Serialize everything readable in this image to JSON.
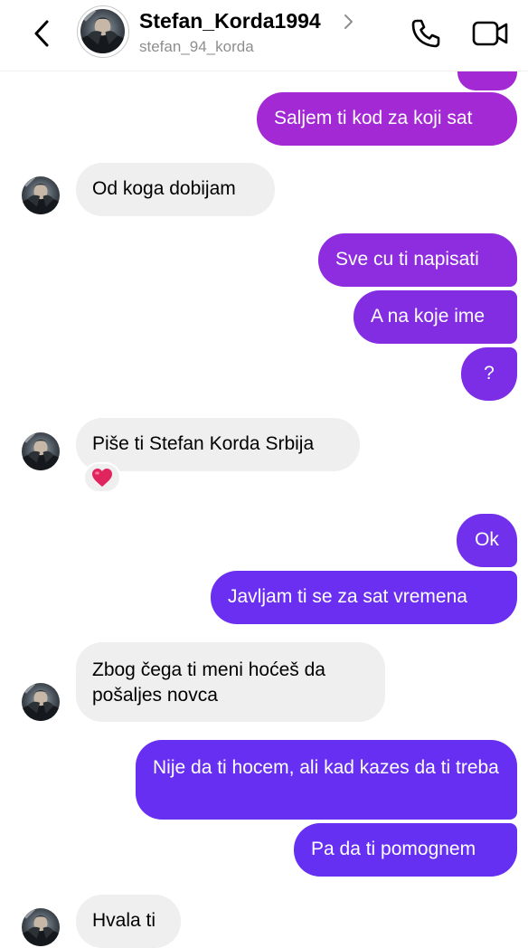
{
  "header": {
    "username": "Stefan_Korda1994",
    "handle": "stefan_94_korda"
  },
  "icons": {
    "back": "chevron-left-icon",
    "profile_chevron": "chevron-right-icon",
    "call": "phone-icon",
    "video": "video-camera-icon",
    "reaction": "red-heart-icon"
  },
  "colors": {
    "outgoing_top": "#a62bd6",
    "outgoing_bottom": "#6b2bf0",
    "incoming": "#efefef",
    "heart": "#e0245e"
  },
  "messages": [
    {
      "direction": "out",
      "text": "Saljem ti kod za koji sat"
    },
    {
      "direction": "in",
      "text": "Od koga dobijam"
    },
    {
      "direction": "out",
      "text": "Sve cu ti napisati"
    },
    {
      "direction": "out",
      "text": "A na koje ime"
    },
    {
      "direction": "out",
      "text": "?"
    },
    {
      "direction": "in",
      "text": "Piše ti Stefan Korda Srbija",
      "reaction": "❤️"
    },
    {
      "direction": "out",
      "text": "Ok"
    },
    {
      "direction": "out",
      "text": "Javljam ti se za sat vremena"
    },
    {
      "direction": "in",
      "text": "Zbog čega ti meni hoćeš da pošaljes novca"
    },
    {
      "direction": "out",
      "text": "Nije da ti hocem, ali kad kazes da ti treba"
    },
    {
      "direction": "out",
      "text": "Pa da ti pomognem"
    },
    {
      "direction": "in",
      "text": "Hvala ti"
    }
  ]
}
